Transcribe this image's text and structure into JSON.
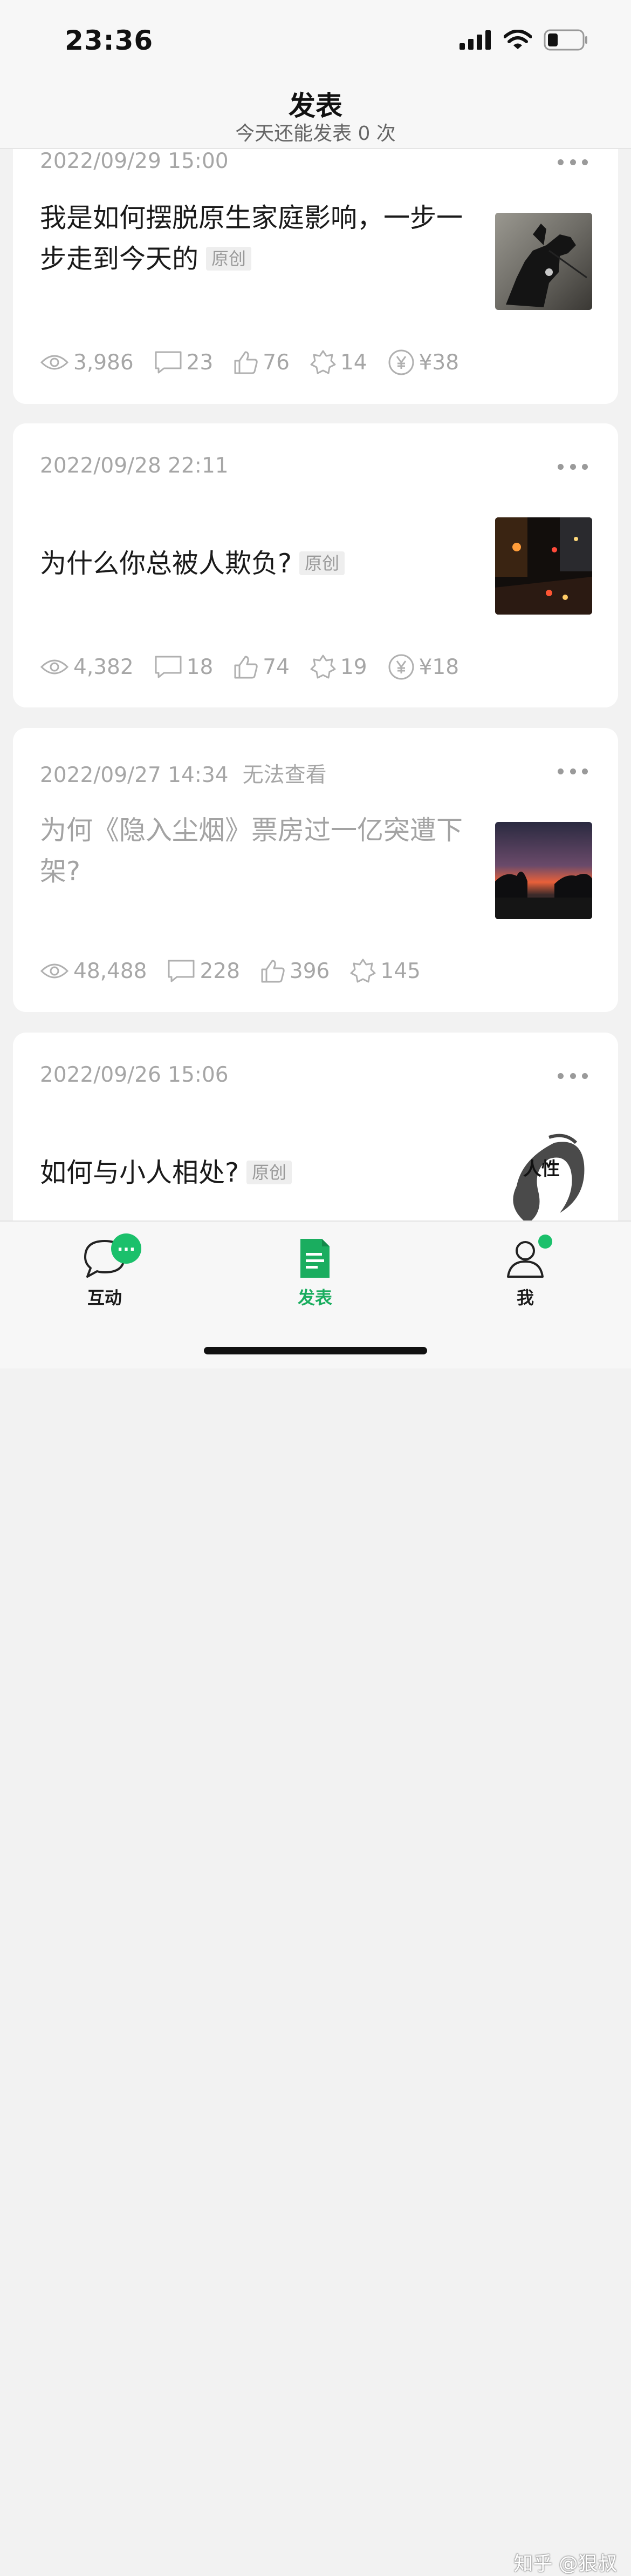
{
  "status": {
    "time": "23:36"
  },
  "header": {
    "title": "发表",
    "subtitle": "今天还能发表 0 次"
  },
  "posts": [
    {
      "date": "2022/09/29 15:00",
      "title": "我是如何摆脱原生家庭影响，一步一步走到今天的",
      "tag": "原创",
      "views": "3,986",
      "comments": "23",
      "likes": "76",
      "favorites": "14",
      "earnings": "¥38",
      "thumb_icon": "horse-statue-image"
    },
    {
      "date": "2022/09/28 22:11",
      "title": "为什么你总被人欺负?",
      "tag": "原创",
      "views": "4,382",
      "comments": "18",
      "likes": "74",
      "favorites": "19",
      "earnings": "¥18",
      "thumb_icon": "night-street-image"
    },
    {
      "date": "2022/09/27 14:34",
      "status": "无法查看",
      "title": "为何《隐入尘烟》票房过一亿突遭下架?",
      "views": "48,488",
      "comments": "228",
      "likes": "396",
      "favorites": "145",
      "thumb_icon": "sunset-image"
    },
    {
      "date": "2022/09/26 15:06",
      "title": "如何与小人相处?",
      "tag": "原创",
      "thumb_text": "人性",
      "thumb_icon": "ink-calligraphy-image"
    }
  ],
  "tabbar": {
    "interact_label": "互动",
    "interact_badge": "...",
    "publish_label": "发表",
    "me_label": "我",
    "active_color": "#1aad5f"
  },
  "watermark": "知乎 @狠叔"
}
